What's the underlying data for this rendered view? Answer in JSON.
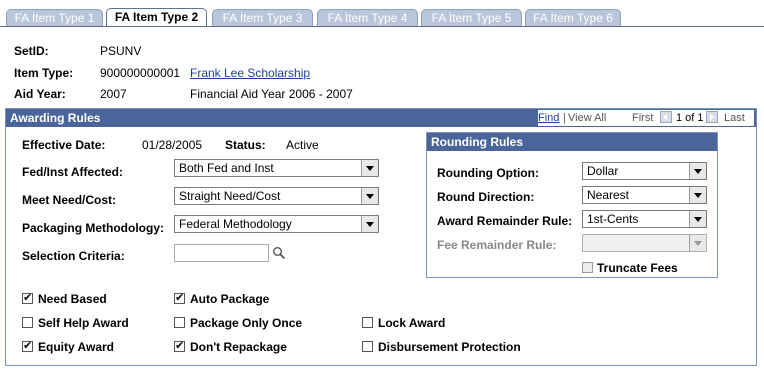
{
  "tabs": [
    {
      "label": "FA Item Type 1"
    },
    {
      "label": "FA Item Type 2"
    },
    {
      "label": "FA Item Type 3"
    },
    {
      "label": "FA Item Type 4"
    },
    {
      "label": "FA Item Type 5"
    },
    {
      "label": "FA Item Type 6"
    }
  ],
  "header": {
    "setid_label": "SetID:",
    "setid_value": "PSUNV",
    "item_type_label": "Item Type:",
    "item_type_value": "900000000001",
    "item_type_link": "Frank Lee Scholarship",
    "aid_year_label": "Aid Year:",
    "aid_year_value": "2007",
    "aid_year_desc": "Financial Aid Year 2006 - 2007"
  },
  "awarding": {
    "title": "Awarding Rules",
    "nav": {
      "find": "Find",
      "view_all": "View All",
      "first": "First",
      "count": "1 of 1",
      "last": "Last",
      "separator": "|"
    },
    "effective_date_label": "Effective Date:",
    "effective_date_value": "01/28/2005",
    "status_label": "Status:",
    "status_value": "Active",
    "fed_inst_label": "Fed/Inst Affected:",
    "fed_inst_value": "Both Fed and Inst",
    "meet_need_label": "Meet Need/Cost:",
    "meet_need_value": "Straight Need/Cost",
    "packaging_label": "Packaging Methodology:",
    "packaging_value": "Federal Methodology",
    "selection_label": "Selection Criteria:",
    "selection_value": ""
  },
  "rounding": {
    "title": "Rounding Rules",
    "option_label": "Rounding Option:",
    "option_value": "Dollar",
    "direction_label": "Round Direction:",
    "direction_value": "Nearest",
    "remainder_label": "Award Remainder Rule:",
    "remainder_value": "1st-Cents",
    "fee_remainder_label": "Fee Remainder Rule:",
    "fee_remainder_value": "",
    "truncate_label": "Truncate Fees"
  },
  "checks": {
    "need_based": "Need Based",
    "self_help": "Self Help Award",
    "equity": "Equity Award",
    "auto_package": "Auto Package",
    "package_once": "Package Only Once",
    "dont_repackage": "Don't Repackage",
    "lock_award": "Lock Award",
    "disbursement": "Disbursement Protection"
  }
}
